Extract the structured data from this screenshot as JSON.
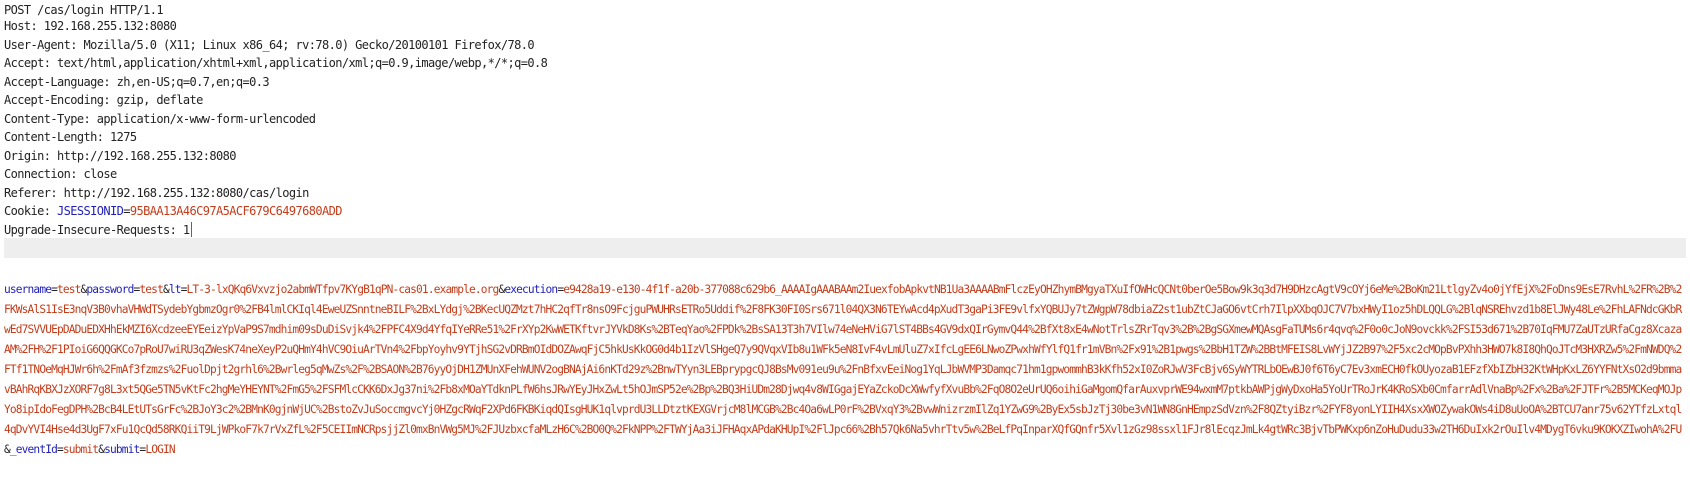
{
  "request": {
    "request_line": "POST /cas/login HTTP/1.1",
    "headers": [
      "Host: 192.168.255.132:8080",
      "User-Agent: Mozilla/5.0 (X11; Linux x86_64; rv:78.0) Gecko/20100101 Firefox/78.0",
      "Accept: text/html,application/xhtml+xml,application/xml;q=0.9,image/webp,*/*;q=0.8",
      "Accept-Language: zh,en-US;q=0.7,en;q=0.3",
      "Accept-Encoding: gzip, deflate",
      "Content-Type: application/x-www-form-urlencoded",
      "Content-Length: 1275",
      "Origin: http://192.168.255.132:8080",
      "Connection: close",
      "Referer: http://192.168.255.132:8080/cas/login"
    ],
    "cookie": {
      "label": "Cookie: ",
      "name": "JSESSIONID",
      "eq": "=",
      "value": "95BAA13A46C97A5ACF679C6497680ADD"
    },
    "upgrade_header": "Upgrade-Insecure-Requests: 1"
  },
  "colors": {
    "param_name": "#1f1fb8",
    "param_value": "#c43c1a",
    "caret": "#b04a20",
    "current_line": "#eeeeee"
  },
  "body": {
    "params": [
      {
        "name": "username",
        "value": "test"
      },
      {
        "name": "password",
        "value": "test"
      },
      {
        "name": "lt",
        "value": "LT-3-lxQKq6Vxvzjo2abmWTfpv7KYgB1qPN-cas01.example.org"
      },
      {
        "name": "execution",
        "value": "e9428a19-e130-4f1f-a20b-377088c629b6_AAAAIgAAABAAm2IuexfobApkvtNB1Ua3AAAABmFlczEyOHZhymBMgyaTXuIfOWHcQCNt0berOe5Bow9k3q3d7H9DHzcAgtV9cOYj6eMe%2BoKm21LtlgyZv4o0jYfEjX%2FoDns9EsE7RvhL%2FR%2B%2FKWsAlS1IsE3nqV3B0vhaVHWdTSydebYgbmzOgr0%2FB4lmlCKIql4EweUZSnntneBILF%2BxLYdgj%2BKecUQZMzt7hHC2qfTr8nsO9FcjguPWUHRsETRo5Uddif%2F8FK30FI0Srs671l04QX3N6TEYwAcd4pXudT3gaPi3FE9vlfxYQBUJy7tZWgpW78dbiaZ2st1ubZtCJaGO6vtCrh7IlpXXbqOJC7V7bxHWyI1oz5hDLQQLG%2BlqNSREhvzd1b8ElJWy48Le%2FhLAFNdcGKbRwEd7SVVUEpDADuEDXHhEkMZI6XcdzeeEYEeizYpVaP9S7mdhim09sDuDiSvjk4%2FPFC4X9d4YfqIYeRRe51%2FrXYp2KwWETKftvrJYVkD8Ks%2BTeqYao%2FPDk%2BsSA13T3h7VIlw74eNeHViG7lST4BBs4GV9dxQIrGymvQ44%2BfXt8xE4wNotTrlsZRrTqv3%2B%2BgSGXmewMQAsgFaTUMs6r4qvq%2F0o0cJoN9ovckk%2FSI53d671%2B70IqFMU7ZaUTzURfaCgz8XcazaAM%2FH%2F1PIoiG6QQGKCo7pRoU7wiRU3qZWesK74neXeyP2uQHmY4hVC9OiuArTVn4%2FbpYoyhv9YTjhSG2vDRBmOIdDOZAwqFjC5hkUsKkOG0d4b1IzVlSHgeQ7y9QVqxVIb8u1WFk5eN8IvF4vLmUluZ7xIfcLgEE6LNwoZPwxhWfYlfQ1fr1mVBn%2Fx91%2B1pwgs%2BbH1TZW%2BBtMFEIS8LvWYjJZ2B97%2F5xc2cMOpBvPXhh3HWO7k8I8QhQoJTcM3HXRZw5%2FmNWDQ%2FTf1TNOeMqHJWr6h%2FmAf3fzmzs%2FuolDpjt2grhl6%2Bwrleg5qMwZs%2F%2BSAON%2B76yyOjDH1ZMUnXFehWUNV2ogBNAjAi6nKTd29z%2BnwTYyn3LEBprypgcQJ8BsMv091eu9u%2FnBfxvEeiNog1YqLJbWVMP3Damqc71hm1gpwommhB3kKfh52xI0ZoRJwV3FcBjv6SyWYTRLbOEwBJ0f6T6yC7Ev3xmECH0fkOUyozaB1EFzfXbIZbH32KtWHpKxLZ6YYFNtXsO2d9bmmavBAhRqKBXJzXORF7g8L3xt5QGe5TN5vKtFc2hgMeYHEYNT%2FmG5%2FSFMlcCKK6DxJg37ni%2Fb8xMOaYTdknPLfW6hsJRwYEyJHxZwLt5hOJmSP52e%2Bp%2BQ3HiUDm28Djwq4v8WIGgajEYaZckoDcXWwfyfXvuBb%2FqO8O2eUrUQ6oihiGaMgomQfarAuxvprWE94wxmM7ptkbAWPjgWyDxoHa5YoUrTRoJrK4KRoSXb0CmfarrAdlVnaBp%2Fx%2Ba%2FJTFr%2B5MCKeqMOJpYo8ipIdoFegDPH%2BcB4LEtUTsGrFc%2BJoY3c2%2BMnK0gjnWjUC%2BstoZvJuSoccmgvcYj0HZgcRWqF2XPd6FKBKiqdQIsgHUK1qlvprdU3LLDtztKEXGVrjcM8lMCGB%2Bc4Oa6wLP0rF%2BVxqY3%2BvwWnizrzmIlZq1YZwG9%2ByEx5sbJzTj30be3vN1WN8GnHEmpzSdVzn%2F8QZtyiBzr%2FYF8yonLYIIH4XsxXWOZywakOWs4iD8uUoOA%2BTCU7anr75v62YTfzLxtql4qDvYVI4Hse4d3UgF7xFu1QcQd58RKQiiT9LjWPkoF7k7rVxZfL%2F5CEIImNCRpsjjZl0mxBnVWg5MJ%2FJUzbxcfaMLzH6C%2BO0Q%2FkNPP%2FTWYjAa3iJFHAqxAPdaKHUpI%2FlJpc66%2Bh57Qk6Na5vhrTtv5w%2BeLfPqInparXQfGQnfr5Xvl1zGz98ssxl1FJr8lEcqzJmLk4gtWRc3BjvTbPWKxp6nZoHuDudu33w2TH6DuIxk2rOuIlv4MDygT6vku9KOKXZIwohA%2FU"
      },
      {
        "name": "_eventId",
        "value": "submit"
      },
      {
        "name": "submit",
        "value": "LOGIN"
      }
    ]
  }
}
